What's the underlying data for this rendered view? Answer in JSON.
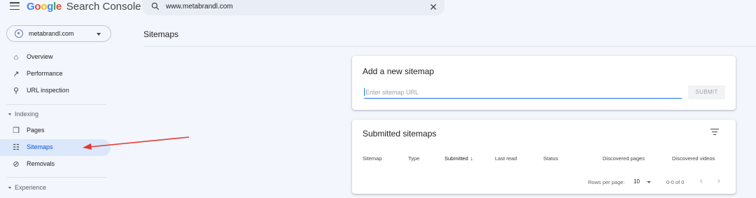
{
  "header": {
    "logo_google": "Google",
    "logo_product": "Search Console",
    "search_value": "www.metabrandl.com",
    "close_glyph": "✕"
  },
  "property": {
    "name": "metabrandl.com"
  },
  "sidebar": {
    "items": [
      {
        "label": "Overview",
        "icon": "home-icon",
        "glyph": "⌂"
      },
      {
        "label": "Performance",
        "icon": "trend-icon",
        "glyph": "↗"
      },
      {
        "label": "URL inspection",
        "icon": "search-icon",
        "glyph": "⚲"
      }
    ],
    "indexing_label": "Indexing",
    "indexing_items": [
      {
        "label": "Pages",
        "icon": "pages-icon",
        "glyph": "❐"
      },
      {
        "label": "Sitemaps",
        "icon": "sitemap-icon",
        "glyph": "☷",
        "active": true
      },
      {
        "label": "Removals",
        "icon": "removals-icon",
        "glyph": "⊘"
      }
    ],
    "experience_label": "Experience"
  },
  "main": {
    "page_title": "Sitemaps",
    "add_card": {
      "title": "Add a new sitemap",
      "placeholder": "Enter sitemap URL",
      "submit_label": "SUBMIT"
    },
    "submitted_card": {
      "title": "Submitted sitemaps",
      "columns": [
        "Sitemap",
        "Type",
        "Submitted",
        "Last read",
        "Status",
        "Discovered pages",
        "Discovered videos"
      ],
      "sort_arrow": "↓",
      "rows_per_page_label": "Rows per page:",
      "rows_per_page_value": "10",
      "range": "0-0 of 0",
      "prev_glyph": "‹",
      "next_glyph": "›"
    }
  },
  "colors": {
    "accent": "#0b57d0",
    "active_bg": "#dbe7fb",
    "annotation_arrow": "#e53935"
  }
}
